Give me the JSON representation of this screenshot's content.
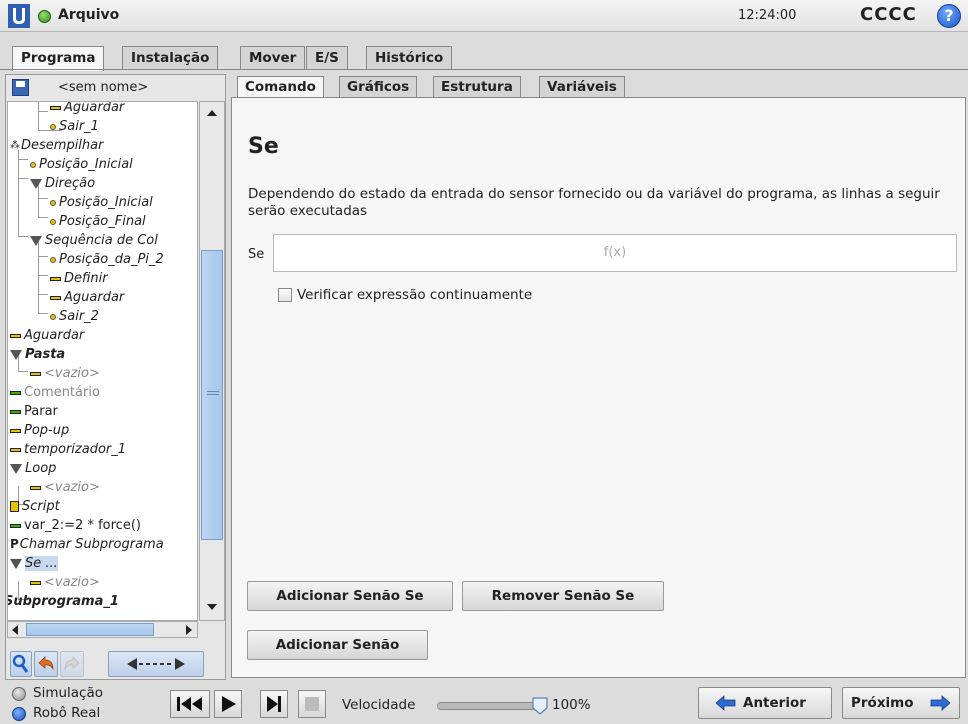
{
  "header": {
    "menu_label": "Arquivo",
    "clock": "12:24:00",
    "robot_name": "CCCC",
    "help": "?"
  },
  "main_tabs": [
    "Programa",
    "Instalação",
    "Mover",
    "E/S",
    "Histórico"
  ],
  "program": {
    "file_name": "<sem nome>",
    "tree": [
      {
        "label": "Aguardar",
        "icon": "wait-icon"
      },
      {
        "label": "Sair_1",
        "icon": "waypoint-icon"
      },
      {
        "label": "Desempilhar",
        "icon": "palletize-icon"
      },
      {
        "label": "Posição_Inicial",
        "icon": "waypoint-icon"
      },
      {
        "label": "Direção",
        "icon": "folder-icon"
      },
      {
        "label": "Posição_Inicial",
        "icon": "waypoint-icon"
      },
      {
        "label": "Posição_Final",
        "icon": "waypoint-icon"
      },
      {
        "label": "Sequência de Col",
        "icon": "folder-icon"
      },
      {
        "label": "Posição_da_Pi_2",
        "icon": "waypoint-icon"
      },
      {
        "label": "Definir",
        "icon": "set-icon"
      },
      {
        "label": "Aguardar",
        "icon": "wait-icon"
      },
      {
        "label": "Sair_2",
        "icon": "waypoint-icon"
      },
      {
        "label": "Aguardar",
        "icon": "wait-icon"
      },
      {
        "label": "Pasta",
        "icon": "folder-icon"
      },
      {
        "label": "<vazio>",
        "icon": "empty-icon"
      },
      {
        "label": "Comentário",
        "icon": "comment-icon"
      },
      {
        "label": "Parar",
        "icon": "stop-icon"
      },
      {
        "label": "Pop-up",
        "icon": "popup-icon"
      },
      {
        "label": "temporizador_1",
        "icon": "timer-icon"
      },
      {
        "label": "Loop",
        "icon": "loop-icon"
      },
      {
        "label": "<vazio>",
        "icon": "empty-icon"
      },
      {
        "label": "Script",
        "icon": "script-icon"
      },
      {
        "label": "var_2:=2 * force()",
        "icon": "assignment-icon"
      },
      {
        "label": "Chamar Subprograma",
        "icon": "call-icon"
      },
      {
        "label": "Se ...",
        "icon": "if-icon"
      },
      {
        "label": "<vazio>",
        "icon": "empty-icon"
      },
      {
        "label": "Subprograma_1",
        "icon": "subprogram-icon"
      }
    ]
  },
  "content_tabs": [
    "Comando",
    "Gráficos",
    "Estrutura",
    "Variáveis"
  ],
  "command": {
    "title": "Se",
    "description": "Dependendo do estado da entrada do sensor fornecido ou da variável do programa, as linhas a seguir serão executadas",
    "if_label": "Se",
    "expression_placeholder": "f(x)",
    "check_continuously_label": "Verificar expressão continuamente",
    "add_elseif": "Adicionar Senão Se",
    "remove_elseif": "Remover Senão Se",
    "add_else": "Adicionar Senão"
  },
  "footer": {
    "simulation_label": "Simulação",
    "real_robot_label": "Robô Real",
    "speed_label": "Velocidade",
    "speed_value": "100%",
    "speed_fraction": 1.0,
    "previous_label": "Anterior",
    "next_label": "Próximo"
  },
  "colors": {
    "accent_blue": "#3a66b6",
    "status_green": "#2c8b1e",
    "wait_yellow": "#e8c200"
  }
}
